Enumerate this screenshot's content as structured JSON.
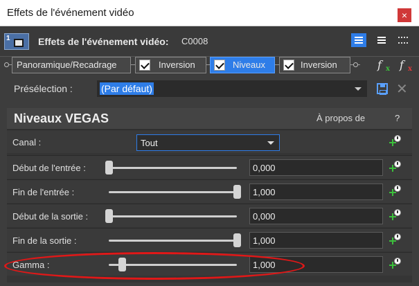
{
  "window": {
    "title": "Effets de l'événement vidéo",
    "close_glyph": "×"
  },
  "header": {
    "thumb_number": "1",
    "label": "Effets de l'événement vidéo:",
    "event_name": "C0008",
    "view_buttons": [
      "list-view-icon",
      "detail-view-icon",
      "grid-view-icon"
    ],
    "active_view": "list-view-icon"
  },
  "chain": {
    "plugins": [
      {
        "label": "Panoramique/Recadrage",
        "checkbox": false,
        "selected": false
      },
      {
        "label": "Inversion",
        "checkbox": true,
        "selected": false
      },
      {
        "label": "Niveaux",
        "checkbox": true,
        "selected": true
      },
      {
        "label": "Inversion",
        "checkbox": true,
        "selected": false
      }
    ],
    "fx_add_glyph": "f",
    "fx_add_sub": "x",
    "fx_remove_glyph": "f",
    "fx_remove_sub": "x"
  },
  "preset": {
    "label": "Présélection :",
    "value": "(Par défaut)"
  },
  "panel": {
    "title": "Niveaux VEGAS",
    "about": "À propos de",
    "help": "?",
    "channel": {
      "label": "Canal :",
      "value": "Tout"
    },
    "params": [
      {
        "label": "Début de l'entrée :",
        "value": "0,000",
        "level": 0.0
      },
      {
        "label": "Fin de l'entrée :",
        "value": "1,000",
        "level": 1.0
      },
      {
        "label": "Début de la sortie :",
        "value": "0,000",
        "level": 0.0
      },
      {
        "label": "Fin de la sortie :",
        "value": "1,000",
        "level": 1.0
      },
      {
        "label": "Gamma :",
        "value": "1,000",
        "level": 0.1
      }
    ]
  },
  "colors": {
    "accent": "#2e7de8",
    "highlight_ring": "#e01818",
    "keyframe_green": "#3cbf3c"
  }
}
